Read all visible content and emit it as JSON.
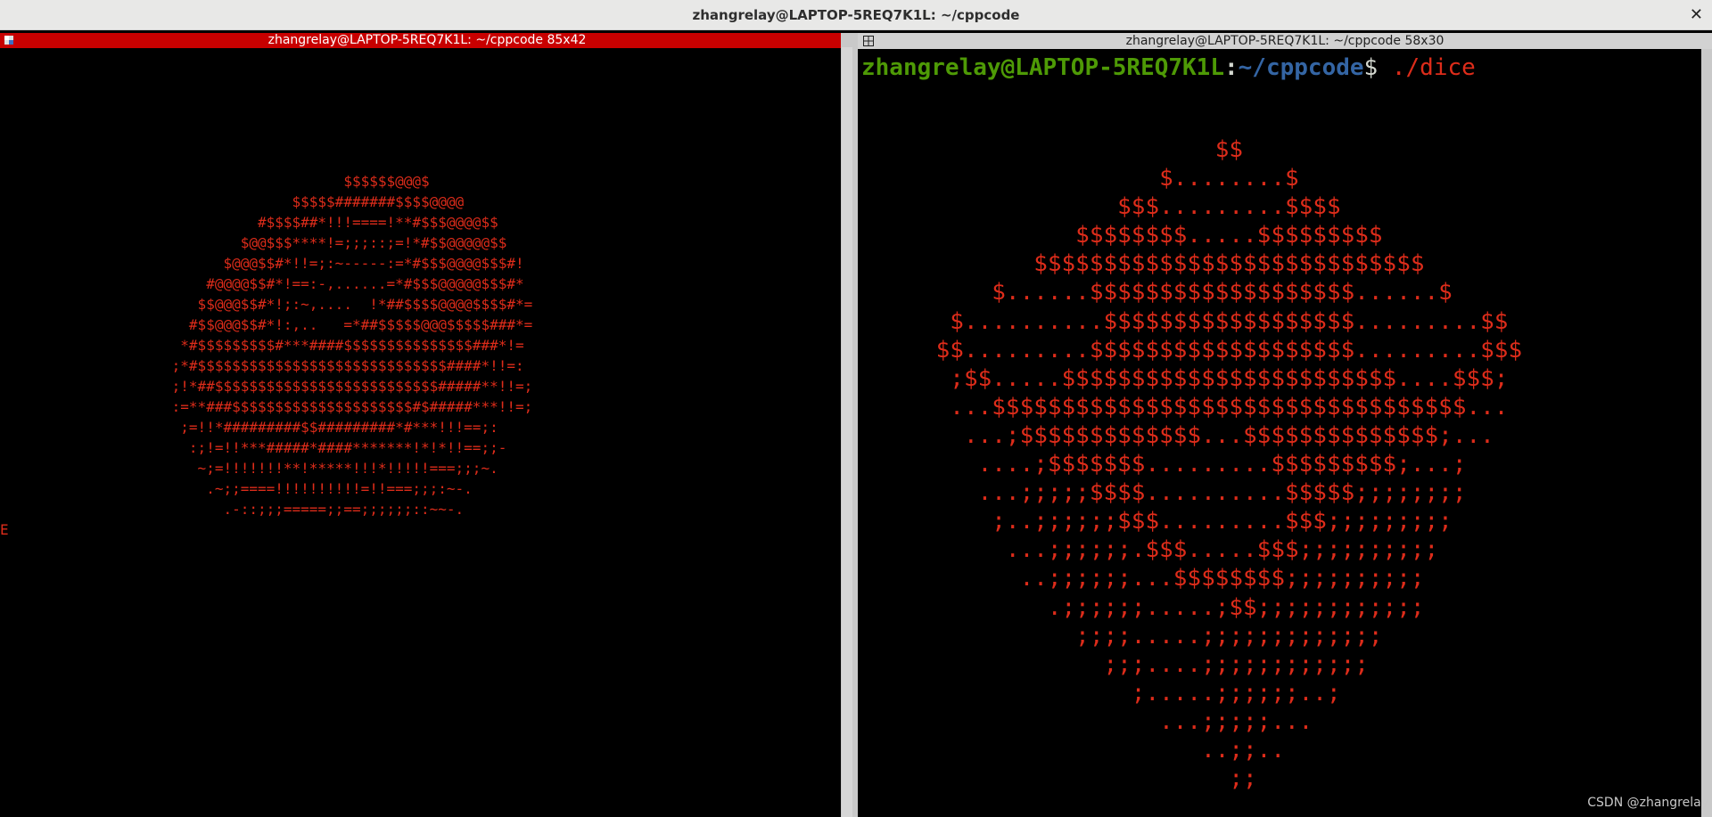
{
  "window": {
    "title": "zhangrelay@LAPTOP-5REQ7K1L: ~/cppcode",
    "close_glyph": "✕"
  },
  "left_pane": {
    "title": "zhangrelay@LAPTOP-5REQ7K1L: ~/cppcode 85x42",
    "title_bg": "#c80000",
    "art_color": "#dd2c1a",
    "art": "\n\n\n\n\n\n                                        $$$$$$@@@$\n                                  $$$$$#######$$$$@@@@\n                              #$$$$##*!!!====!**#$$$@@@@$$\n                            $@@$$$****!=;;;::;=!*#$$@@@@@$$\n                          $@@@$$#*!!=;:~-----:=*#$$$@@@@$$$#!\n                        #@@@@$$#*!==:-,......=*#$$$@@@@@$$$#*\n                       $$@@@$$#*!;:~,....  !*##$$$$@@@@$$$$#*=\n                      #$$@@@$$#*!:,..   =*##$$$$$@@@$$$$$###*=\n                     *#$$$$$$$$$#***####$$$$$$$$$$$$$$$###*!=\n                    ;*#$$$$$$$$$$$$$$$$$$$$$$$$$$$$$####*!!=:\n                    ;!*##$$$$$$$$$$$$$$$$$$$$$$$$$$#####**!!=;\n                    :=**###$$$$$$$$$$$$$$$$$$$$$#$#####***!!=;\n                     ;=!!*#########$$#########*#***!!!==;:\n                      :;!=!!***#####*####*******!*!*!!==;;-\n                       ~;=!!!!!!!**!*****!!!*!!!!!===;;;~.\n                        .~;;====!!!!!!!!!!=!!===;;;:~-.\n                          .-::;;;=====;;==;;;;;;::~~-.\nE",
    "icon": "tilix-pane-icon"
  },
  "right_pane": {
    "title": "zhangrelay@LAPTOP-5REQ7K1L: ~/cppcode 58x30",
    "title_bg": "#d2d2d2",
    "prompt": {
      "user_host": "zhangrelay@LAPTOP-5REQ7K1L",
      "colon": ":",
      "path": "~/cppcode",
      "dollar": "$",
      "command": " ./dice"
    },
    "art_color": "#dd2c1a",
    "art": "                     $$\n                 $........$\n              $$$.........$$$$\n           $$$$$$$$.....$$$$$$$$$\n        $$$$$$$$$$$$$$$$$$$$$$$$$$$$\n     $......$$$$$$$$$$$$$$$$$$$......$\n  $..........$$$$$$$$$$$$$$$$$$.........$$\n $$.........$$$$$$$$$$$$$$$$$$$.........$$$\n  ;$$.....$$$$$$$$$$$$$$$$$$$$$$$$....$$$;\n  ...$$$$$$$$$$$$$$$$$$$$$$$$$$$$$$$$$$...\n   ...;$$$$$$$$$$$$$...$$$$$$$$$$$$$$;...\n    ....;$$$$$$$.........$$$$$$$$$;...;\n    ...;;;;;$$$$..........$$$$$;;;;;;;;\n     ;..;;;;;;$$$.........$$$;;;;;;;;;\n      ...;;;;;;.$$$.....$$$;;;;;;;;;;\n       ..;;;;;;...$$$$$$$$;;;;;;;;;;\n         .;;;;;;.....;$$;;;;;;;;;;;;\n           ;;;;.....;;;;;;;;;;;;;\n             ;;;....;;;;;;;;;;;;\n               ;.....;;;;;;..;\n                 ...;;;;;...\n                    ..;;..\n                      ;;",
    "icon": "split-pane-icon"
  },
  "watermark": "CSDN @zhangrelay"
}
